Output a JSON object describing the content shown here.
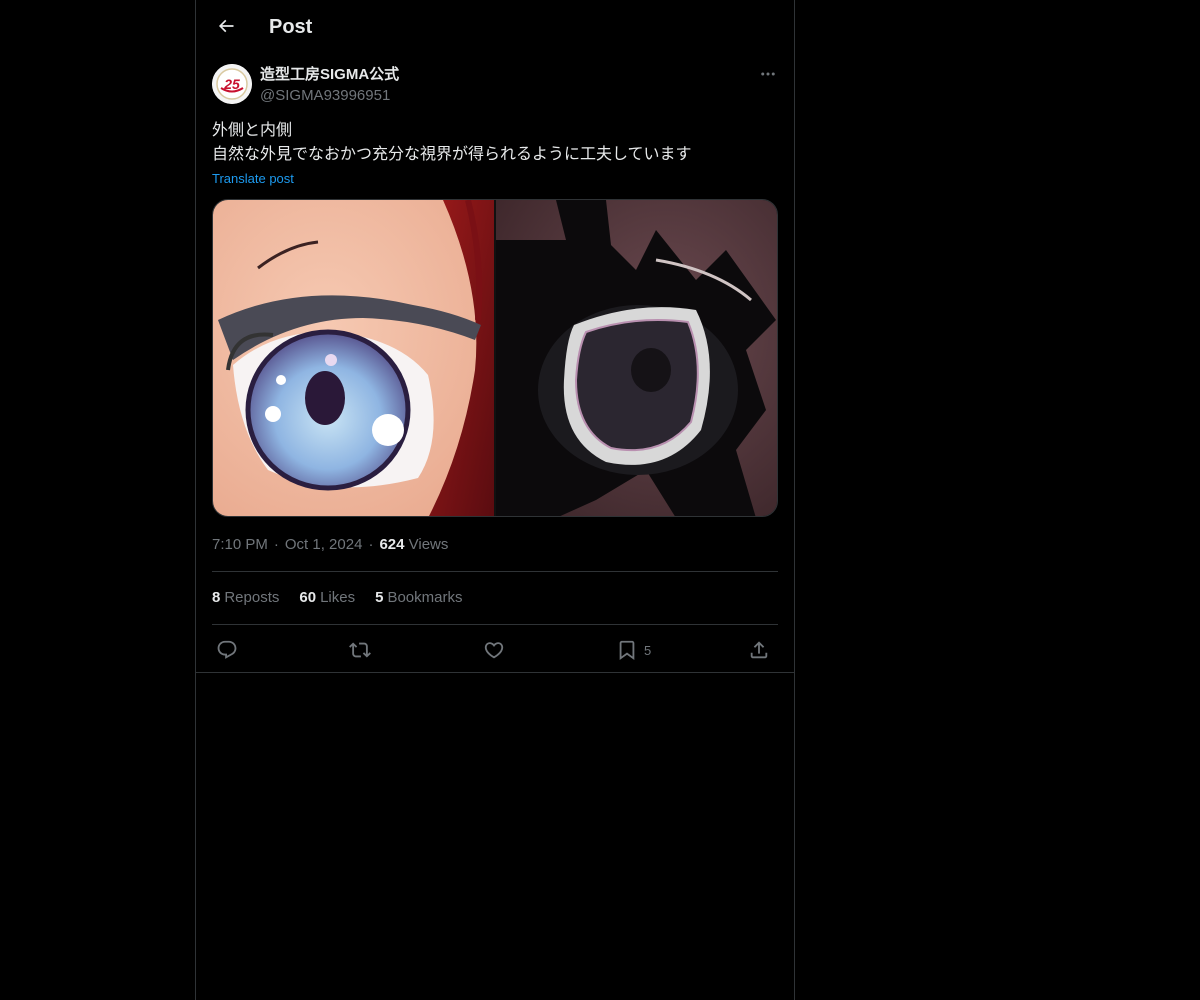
{
  "header": {
    "title": "Post"
  },
  "author": {
    "display_name": "造型工房SIGMA公式",
    "handle": "@SIGMA93996951",
    "avatar_badge": "25"
  },
  "post": {
    "lines": [
      "外側と内側",
      "自然な外見でなおかつ充分な視界が得られるように工夫しています"
    ],
    "translate_label": "Translate post",
    "time": "7:10 PM",
    "date": "Oct 1, 2024",
    "views_count": "624",
    "views_label": "Views"
  },
  "stats": {
    "reposts_count": "8",
    "reposts_label": "Reposts",
    "likes_count": "60",
    "likes_label": "Likes",
    "bookmarks_count": "5",
    "bookmarks_label": "Bookmarks"
  },
  "actions": {
    "bookmark_count": "5"
  },
  "icons": {
    "back": "arrow-left-icon",
    "more": "more-horizontal-icon",
    "reply": "reply-icon",
    "repost": "repost-icon",
    "like": "heart-icon",
    "bookmark": "bookmark-icon",
    "share": "share-icon"
  },
  "colors": {
    "background": "#000000",
    "text_primary": "#e7e9ea",
    "text_secondary": "#71767b",
    "link": "#1d9bf0",
    "border": "#2f3336"
  }
}
